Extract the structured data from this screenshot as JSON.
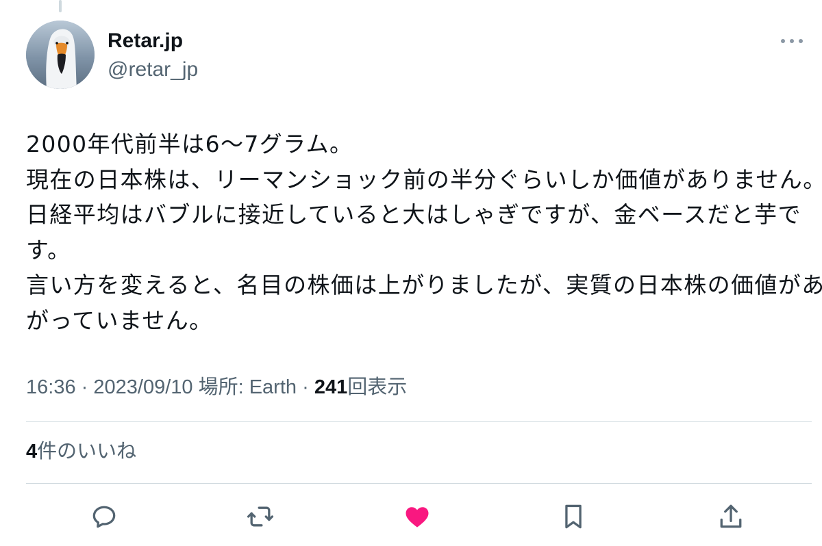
{
  "tweet": {
    "author": {
      "display_name": "Retar.jp",
      "handle": "@retar_jp"
    },
    "text_lines": [
      "2000年代前半は6〜7グラム。",
      "現在の日本株は、リーマンショック前の半分ぐらいしか価値がありません。",
      "日経平均はバブルに接近していると大はしゃぎですが、金ベースだと芋で",
      "す。",
      "言い方を変えると、名目の株価は上がりましたが、実質の日本株の価値があ",
      "がっていません。"
    ],
    "meta": {
      "time": "16:36",
      "separator": "·",
      "date": "2023/09/10",
      "location": "場所: Earth",
      "views_count": "241",
      "views_label": "回表示"
    },
    "likes": {
      "count": "4",
      "label": "件のいいね"
    }
  },
  "icons": {
    "more": "more-horizontal-icon",
    "reply": "reply-icon",
    "retweet": "retweet-icon",
    "like": "heart-filled-icon",
    "bookmark": "bookmark-icon",
    "share": "share-icon"
  },
  "colors": {
    "text_primary": "#0f1419",
    "text_secondary": "#536471",
    "like_pink": "#f91880",
    "divider": "#cfd9de"
  }
}
